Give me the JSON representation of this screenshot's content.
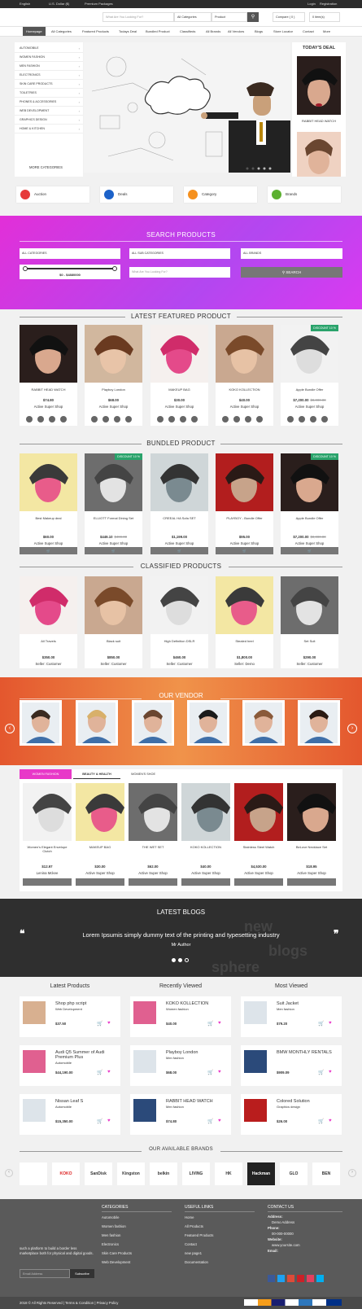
{
  "colors": {
    "accent": "#e22fd8",
    "dark": "#2b2b2b",
    "green": "#2aa36b",
    "vendor": "#e4572e",
    "blue": "#1c62c9"
  },
  "topbar": {
    "language": "English",
    "currency": "U.S. Dollar ($)",
    "premium": "Premium Packages",
    "login": "Login",
    "register": "Registration"
  },
  "header": {
    "search_placeholder": "What Are You Looking For?",
    "category_select": "All Categories",
    "type_select": "Product",
    "compare": "Compare ( 0 )",
    "cart": "0 item(s)"
  },
  "nav": [
    "Homepage",
    "All Categories",
    "Featured Products",
    "Todays Deal",
    "Bundled Product",
    "Classifieds",
    "All Brands",
    "All Vendors",
    "Blogs",
    "Store Locator",
    "Contact",
    "More"
  ],
  "sidebar": {
    "items": [
      "AUTOMOBILE",
      "WOMEN FASHION",
      "MEN FASHION",
      "ELECTRONICS",
      "SKIN CARE PRODUCTS",
      "TOILETRIES",
      "PHONES & ACCESSORIES",
      "WEB DEVELOPMENT",
      "GRAPHICS DESIGN",
      "HOME & KITCHEN"
    ],
    "more": "MORE CATEGORIES"
  },
  "todays_deal": {
    "title": "TODAY'S DEAL",
    "item": "RABBIT HEAD WATCH"
  },
  "quick": [
    "Auction",
    "Deals",
    "Category",
    "Brands"
  ],
  "search_products": {
    "title": "SEARCH PRODUCTS",
    "cat": "ALL CATEGORIES",
    "subcat": "ALL SUB CATEGORIES",
    "brand": "ALL BRANDS",
    "range": "$0 - $4880000",
    "placeholder": "What Are You Looking For?",
    "button": "SEARCH"
  },
  "featured": {
    "title": "LATEST FEATURED PRODUCT",
    "items": [
      {
        "name": "RABBIT HEAD WATCH",
        "price": "$74.80",
        "old": "",
        "shop": "Active Super Shop",
        "badge": ""
      },
      {
        "name": "Playboy London",
        "price": "$68.00",
        "old": "",
        "shop": "Active Super Shop",
        "badge": ""
      },
      {
        "name": "MAKEUP BAG",
        "price": "$30.00",
        "old": "",
        "shop": "Active Super Shop",
        "badge": ""
      },
      {
        "name": "KOKO KOLLECTION",
        "price": "$40.00",
        "old": "",
        "shop": "Active Super Shop",
        "badge": ""
      },
      {
        "name": "Apple Bundle Offer",
        "price": "$7,200.00",
        "old": "$8,000.00",
        "shop": "Active Super Shop",
        "badge": "DISCOUNT 10 %"
      }
    ]
  },
  "bundled": {
    "title": "BUNDLED PRODUCT",
    "items": [
      {
        "name": "Best Makeup deal",
        "price": "$60.00",
        "old": "",
        "shop": "Active Super Shop",
        "badge": ""
      },
      {
        "name": "ELLIOTT Formal Dining Set",
        "price": "$449.10",
        "old": "$499.00",
        "shop": "Active Super Shop",
        "badge": "DISCOUNT 10 %"
      },
      {
        "name": "CREEAL HA Sofa SET",
        "price": "$1,199.00",
        "old": "",
        "shop": "Active Super Shop",
        "badge": ""
      },
      {
        "name": "PLAYBOY - Bundle Offer",
        "price": "$95.00",
        "old": "",
        "shop": "Active Super Shop",
        "badge": ""
      },
      {
        "name": "Apple Bundle Offer",
        "price": "$7,200.00",
        "old": "$8,000.00",
        "shop": "Active Super Shop",
        "badge": "DISCOUNT 10 %"
      }
    ]
  },
  "classified": {
    "title": "CLASSIFIED PRODUCTS",
    "items": [
      {
        "name": "All Travels",
        "price": "$350.00",
        "shop": "Seller: Customer"
      },
      {
        "name": "Black suit",
        "price": "$850.00",
        "shop": "Seller: Customer"
      },
      {
        "name": "High Definition DSLR",
        "price": "$460.00",
        "shop": "Seller: Customer"
      },
      {
        "name": "Stealed heel",
        "price": "$1,800.00",
        "shop": "Seller: Demo"
      },
      {
        "name": "Set Suit",
        "price": "$290.00",
        "shop": "Seller: Customer"
      }
    ]
  },
  "vendor": {
    "title": "OUR VENDOR"
  },
  "tabs": {
    "labels": [
      "WOMEN FASHION",
      "BEAUTY & HEALTH",
      "WOMEN'S SHOE"
    ],
    "items": [
      {
        "name": "Women's Elegant Envelope Clutch",
        "price": "$12.97",
        "shop": "Lenina Mckee"
      },
      {
        "name": "MAKEUP BAG",
        "price": "$30.00",
        "shop": "Active Super Shop"
      },
      {
        "name": "THE WET SET",
        "price": "$62.00",
        "shop": "Active Super Shop"
      },
      {
        "name": "KOKO KOLLECTION",
        "price": "$40.00",
        "shop": "Active Super Shop"
      },
      {
        "name": "Stainless Steel Watch",
        "price": "$4,530.00",
        "shop": "Active Super Shop"
      },
      {
        "name": "BeLove Necklace Set",
        "price": "$18.95",
        "shop": "Active Super Shop"
      }
    ]
  },
  "blogs": {
    "title": "LATEST BLOGS",
    "quote": "Lorem Ipsumis simply dummy text of the printing and typesetting industry",
    "author": "Mr Author"
  },
  "lists": {
    "latest": {
      "title": "Latest Products",
      "items": [
        {
          "t": "Shop php script",
          "c": "Web Development",
          "p": "$37.50"
        },
        {
          "t": "Audi Q5 Summer of Audi Premium Plus",
          "c": "Automobile",
          "p": "$44,190.00"
        },
        {
          "t": "Nissan Leaf S",
          "c": "Automobile",
          "p": "$15,350.00"
        }
      ]
    },
    "recent": {
      "title": "Recently Viewed",
      "items": [
        {
          "t": "KOKO KOLLECTION",
          "c": "Women fashion",
          "p": "$40.00"
        },
        {
          "t": "Playboy London",
          "c": "Men fashion",
          "p": "$68.00"
        },
        {
          "t": "RABBIT HEAD WATCH",
          "c": "Men fashion",
          "p": "$74.80"
        }
      ]
    },
    "most": {
      "title": "Most Viewed",
      "items": [
        {
          "t": "Suit Jacket",
          "c": "Men fashion",
          "p": "$79.20"
        },
        {
          "t": "BMW MONTHLY RENTALS",
          "c": "",
          "p": "$909.09"
        },
        {
          "t": "Colored Solution",
          "c": "Graphics design",
          "p": "$26.00"
        }
      ]
    }
  },
  "brands": {
    "title": "OUR AVAILABLE BRANDS",
    "items": [
      "",
      "KOKO",
      "SanDisk",
      "Kingston",
      "belkin",
      "LIVING",
      "HK",
      "Hackman",
      "GLO",
      "BEN"
    ]
  },
  "footer": {
    "about": "such a platform to build a border less marketplace both for physical and digital goods.",
    "email_placeholder": "Email Address",
    "subscribe": "Subscribe",
    "cat_title": "CATEGORIES",
    "cats": [
      "Automobile",
      "Women fashion",
      "Men fashion",
      "Electronics",
      "Skin Care Products",
      "Web Development"
    ],
    "links_title": "USEFUL LINKS",
    "links": [
      "Home",
      "All Products",
      "Featured Products",
      "Contact",
      "new page1",
      "Documentation"
    ],
    "contact_title": "CONTACT US",
    "address_label": "Address:",
    "address": "Demo Address",
    "phone_label": "Phone:",
    "phone": "00-000-00000",
    "website_label": "Website:",
    "website": "www.yoursite.com",
    "email_label": "Email:"
  },
  "copyright": "2018 © All Rights Reserved | Terms & Condition | Privacy Policy"
}
